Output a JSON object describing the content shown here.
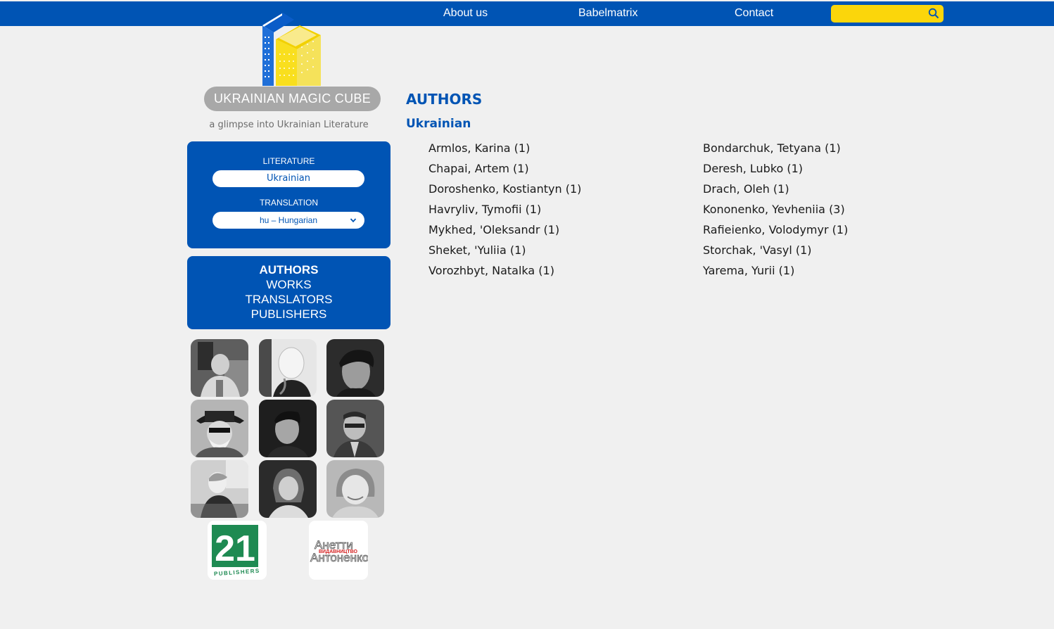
{
  "nav": {
    "about": "About us",
    "babelmatrix": "Babelmatrix",
    "contact": "Contact",
    "search_placeholder": ""
  },
  "logo": {
    "title": "UKRAINIAN MAGIC CUBE",
    "tagline": "a glimpse into Ukrainian Literature"
  },
  "selector": {
    "literature_label": "LITERATURE",
    "literature_value": "Ukrainian",
    "translation_label": "TRANSLATION",
    "translation_value": "hu – Hungarian"
  },
  "menu": {
    "authors": "AUTHORS",
    "works": "WORKS",
    "translators": "TRANSLATORS",
    "publishers": "PUBLISHERS"
  },
  "main": {
    "heading": "AUTHORS",
    "subheading": "Ukrainian",
    "authors_left": [
      "Armlos, Karina (1)",
      "Chapai, Artem (1)",
      "Doroshenko, Kostiantyn (1)",
      "Havryliv, Tymofii (1)",
      "Mykhed, 'Oleksandr (1)",
      "Sheket, 'Yuliia (1)",
      "Vorozhbyt, Natalka (1)"
    ],
    "authors_right": [
      "Bondarchuk, Tetyana (1)",
      "Deresh, Lubko (1)",
      "Drach, Oleh (1)",
      "Kononenko, Yevheniia (3)",
      "Rafieienko, Volodymyr (1)",
      "Storchak, 'Vasyl (1)",
      "Yarema, Yurii (1)"
    ]
  },
  "publishers": {
    "pub21_text": "21",
    "pub21_sub": "PUBLISHERS",
    "anetti_line1": "Анетти",
    "anetti_line2": "Антоненко",
    "anetti_stamp": "ВИДАВНИЦТВО"
  },
  "colors": {
    "brand_blue": "#0054b4",
    "search_yellow": "#fbd60b",
    "background": "#f0f0f0",
    "pub21_green": "#1e8a52",
    "anetti_red": "#d42020"
  }
}
